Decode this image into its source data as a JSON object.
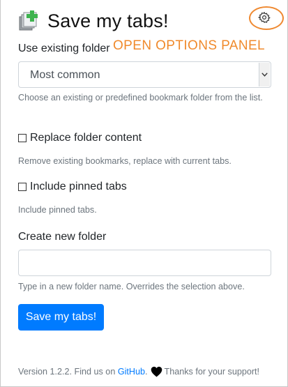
{
  "header": {
    "title": "Save my tabs!",
    "icon": "add-tabs-icon",
    "options_icon": "gear-icon"
  },
  "annotation": "OPEN OPTIONS PANEL",
  "existing_folder": {
    "label": "Use existing folder",
    "selected": "Most common",
    "help": "Choose an existing or predefined bookmark folder from the list."
  },
  "replace": {
    "label": "Replace folder content",
    "checked": false,
    "help": "Remove existing bookmarks, replace with current tabs."
  },
  "pinned": {
    "label": "Include pinned tabs",
    "checked": false,
    "help": "Include pinned tabs."
  },
  "new_folder": {
    "label": "Create new folder",
    "value": "",
    "help": "Type in a new folder name. Overrides the selection above."
  },
  "save_button": "Save my tabs!",
  "footer": {
    "prefix": "Version 1.2.2. Find us on",
    "link": "GitHub",
    "link_suffix": ".",
    "thanks": "Thanks for your support!"
  },
  "colors": {
    "primary": "#007bff",
    "annotation": "#f08a2c",
    "icon_green": "#3fb34f"
  }
}
